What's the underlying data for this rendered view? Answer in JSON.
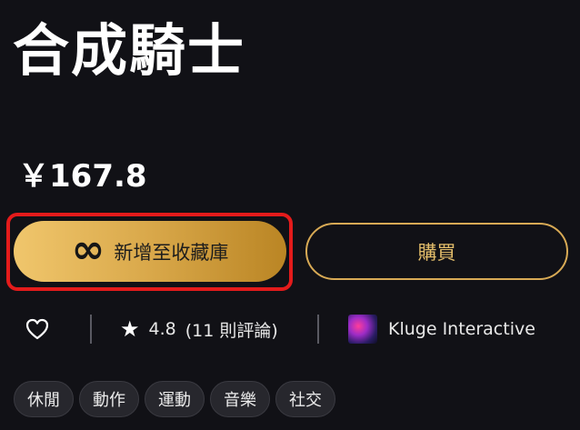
{
  "game": {
    "title": "合成騎士",
    "price": "￥167.8"
  },
  "actions": {
    "library_icon": "infinity-icon",
    "library_label": "新增至收藏庫",
    "buy_label": "購買"
  },
  "meta": {
    "heart_icon": "heart-icon",
    "rating_value": "4.8",
    "rating_count": "(11 則評論)",
    "publisher_name": "Kluge Interactive"
  },
  "tags": [
    "休閒",
    "動作",
    "運動",
    "音樂",
    "社交"
  ],
  "colors": {
    "background": "#111116",
    "accent_gold": "#d9a84a",
    "highlight_red": "#e41b1b"
  }
}
